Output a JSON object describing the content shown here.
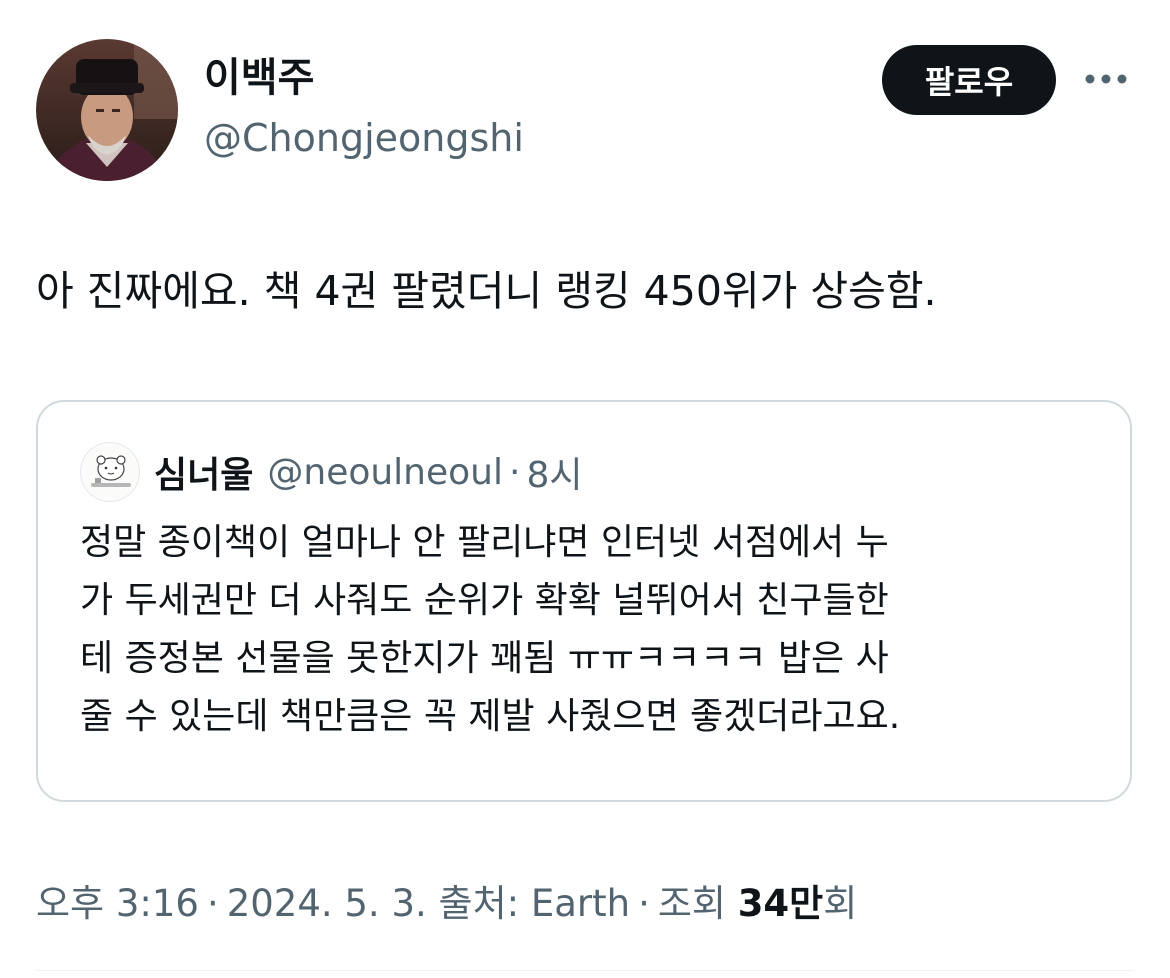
{
  "author": {
    "display_name": "이백주",
    "handle": "@Chongjeongshi"
  },
  "actions": {
    "follow_label": "팔로우",
    "more_icon": "more-horizontal-icon"
  },
  "tweet": {
    "text": "아 진짜에요. 책 4권 팔렸더니 랭킹 450위가 상승함."
  },
  "quote": {
    "display_name": "심너울",
    "handle": "@neoulneoul",
    "separator": "·",
    "time": "8시",
    "lines": [
      "정말 종이책이 얼마나 안 팔리냐면 인터넷 서점에서 누",
      "가 두세권만 더 사줘도 순위가 확확 널뛰어서 친구들한",
      "테 증정본 선물을 못한지가 꽤됨 ㅠㅠㅋㅋㅋㅋ 밥은 사",
      "줄 수 있는데 책만큼은 꼭 제발 사줬으면 좋겠더라고요."
    ]
  },
  "meta": {
    "time": "오후 3:16",
    "sep1": "·",
    "date": "2024. 5. 3.",
    "source": "출처: Earth",
    "sep2": "·",
    "views_prefix": "조회",
    "views_count": "34만",
    "views_suffix": "회"
  },
  "colors": {
    "text_primary": "#0f1419",
    "text_secondary": "#536471",
    "follow_bg": "#0f1419",
    "border": "#cfd9de"
  }
}
